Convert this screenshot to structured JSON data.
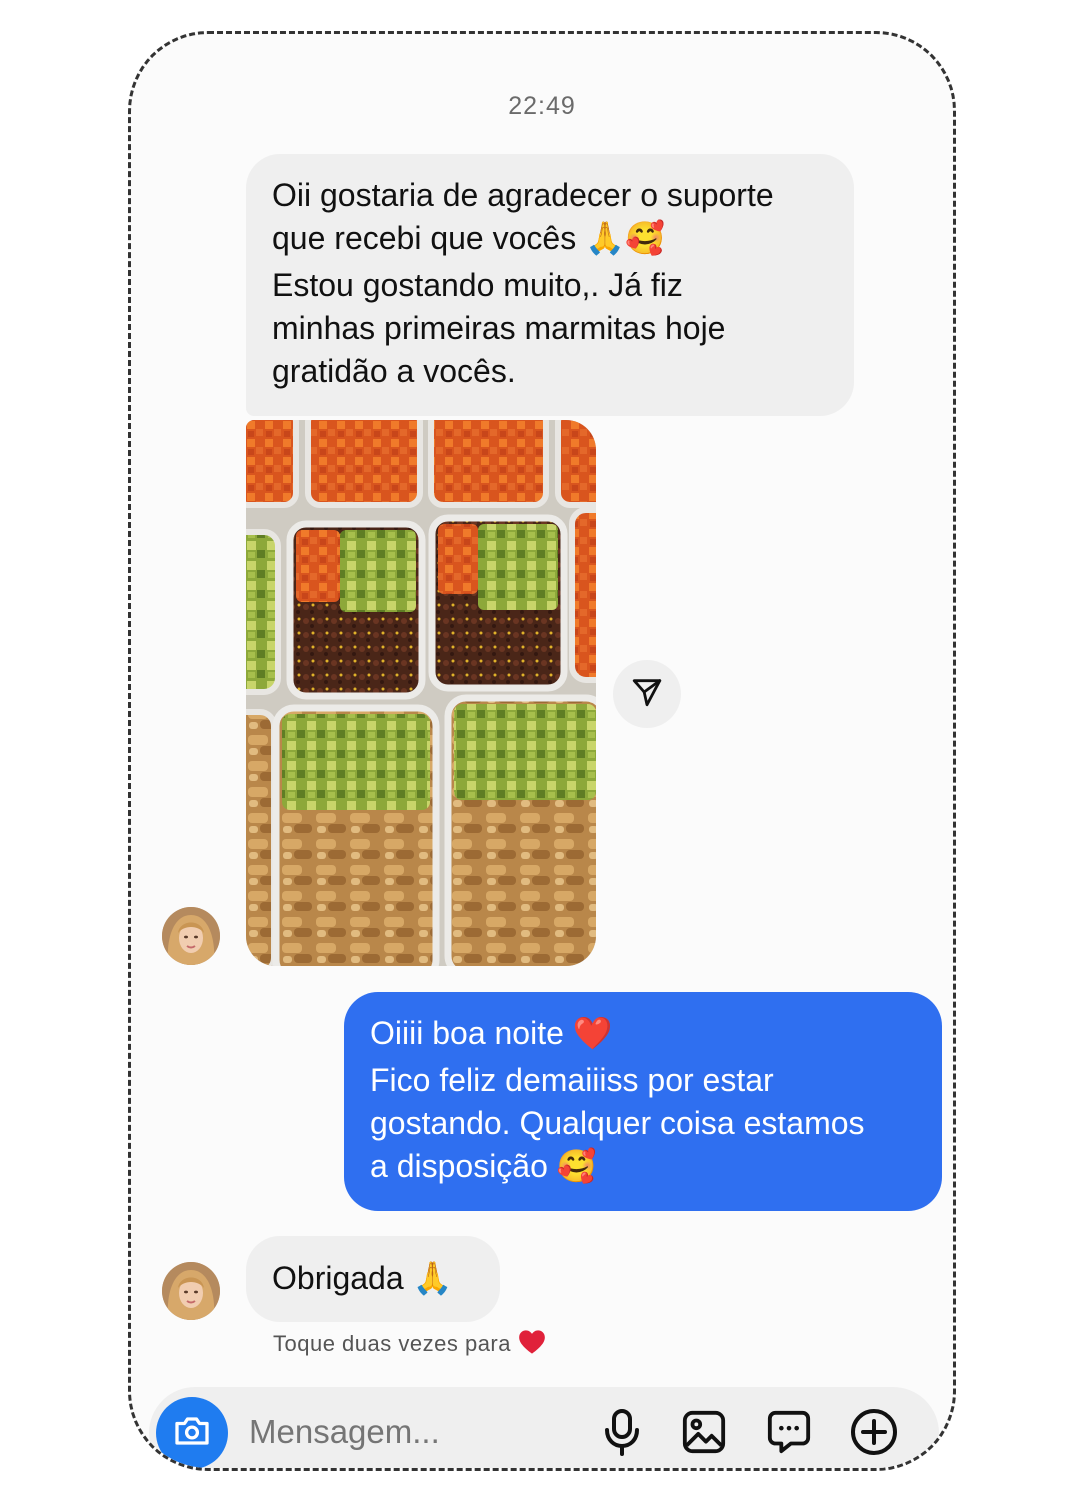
{
  "conversation": {
    "timestamp": "22:49",
    "messages": [
      {
        "sender": "contact",
        "lines": [
          "Oii gostaria de agradecer o suporte",
          "que recebi que vocês 🙏🥰",
          "Estou gostando muito,. Já fiz",
          "minhas primeiras marmitas hoje",
          "gratidão a vocês."
        ]
      },
      {
        "sender": "me",
        "lines": [
          "Oiiii boa noite ❤️",
          "Fico feliz demaiiiss por estar",
          "gostando. Qualquer coisa estamos",
          "a disposição 🥰"
        ]
      },
      {
        "sender": "contact",
        "lines": [
          "Obrigada 🙏"
        ]
      }
    ],
    "reaction_hint": "Toque duas vezes para"
  },
  "composer": {
    "placeholder": "Mensagem..."
  },
  "icons": {
    "camera": "camera-icon",
    "mic": "microphone-icon",
    "gallery": "image-gallery-icon",
    "sticker": "chat-sticker-icon",
    "plus": "plus-circle-icon",
    "share": "paper-plane-icon",
    "heart": "heart-icon"
  },
  "colors": {
    "incoming_bubble": "#efefef",
    "outgoing_bubble": "#2f6ff0",
    "camera_button": "#1f7cf0",
    "heart": "#e0213a"
  }
}
